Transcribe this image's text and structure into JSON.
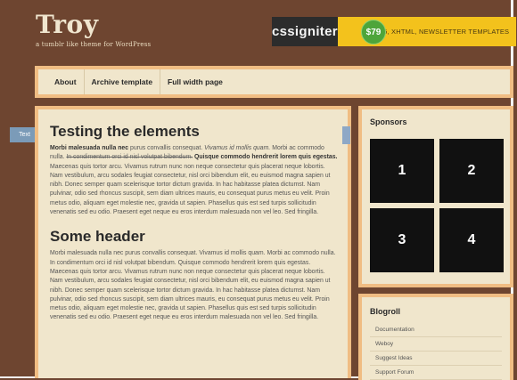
{
  "brand": {
    "title": "Troy",
    "tagline": "a tumblr like theme for WordPress"
  },
  "ad": {
    "brand": "cssigniter",
    "price": "$79",
    "tagline": "HTML5, XHTML, NEWSLETTER TEMPLATES",
    "colors": {
      "dark": "#2c2c2c",
      "price_green": "#4ea53a",
      "banner_yellow": "#f3c21c"
    }
  },
  "nav": {
    "items": [
      "About",
      "Archive template",
      "Full width page"
    ]
  },
  "side_tab": {
    "label": "Text"
  },
  "article": {
    "title": "Testing the elements",
    "p1": {
      "bold_start": "Morbi malesuada nulla nec",
      "text1": " purus convallis consequat. ",
      "italic": "Vivamus id mollis quam.",
      "text2": " Morbi ac commodo nulla. ",
      "strike": "In condimentum orci id nisl volutpat bibendum.",
      "text3": " ",
      "bold_mid": "Quisque commodo hendrerit lorem quis egestas.",
      "text4": " Maecenas quis tortor arcu. Vivamus rutrum nunc non neque consectetur quis placerat neque lobortis. Nam vestibulum, arcu sodales feugiat consectetur, nisl orci bibendum elit, eu euismod magna sapien ut nibh. Donec semper quam scelerisque tortor dictum gravida. In hac habitasse platea dictumst. Nam pulvinar, odio sed rhoncus suscipit, sem diam ultrices mauris, eu consequat purus metus eu velit. Proin metus odio, aliquam eget molestie nec, gravida ut sapien. Phasellus quis est sed turpis sollicitudin venenatis sed eu odio. Praesent eget neque eu eros interdum malesuada non vel leo. Sed fringilla."
    },
    "header": "Some header",
    "p2": "Morbi malesuada nulla nec purus convallis consequat. Vivamus id mollis quam. Morbi ac commodo nulla. In condimentum orci id nisl volutpat bibendum. Quisque commodo hendrerit lorem quis egestas. Maecenas quis tortor arcu. Vivamus rutrum nunc non neque consectetur quis placerat neque lobortis. Nam vestibulum, arcu sodales feugiat consectetur, nisl orci bibendum elit, eu euismod magna sapien ut nibh. Donec semper quam scelerisque tortor dictum gravida. In hac habitasse platea dictumst. Nam pulvinar, odio sed rhoncus suscipit, sem diam ultrices mauris, eu consequat purus metus eu velit. Proin metus odio, aliquam eget molestie nec, gravida ut sapien. Phasellus quis est sed turpis sollicitudin venenatis sed eu odio. Praesent eget neque eu eros interdum malesuada non vel leo. Sed fringilla."
  },
  "sponsors": {
    "title": "Sponsors",
    "boxes": [
      "1",
      "2",
      "3",
      "4"
    ]
  },
  "blogroll": {
    "title": "Blogroll",
    "links": [
      "Documentation",
      "Weboy",
      "Suggest Ideas",
      "Support Forum"
    ]
  },
  "colors": {
    "page_bg": "#6e4530",
    "box_border": "#f0bd83",
    "box_bg": "#f0e6cc"
  }
}
